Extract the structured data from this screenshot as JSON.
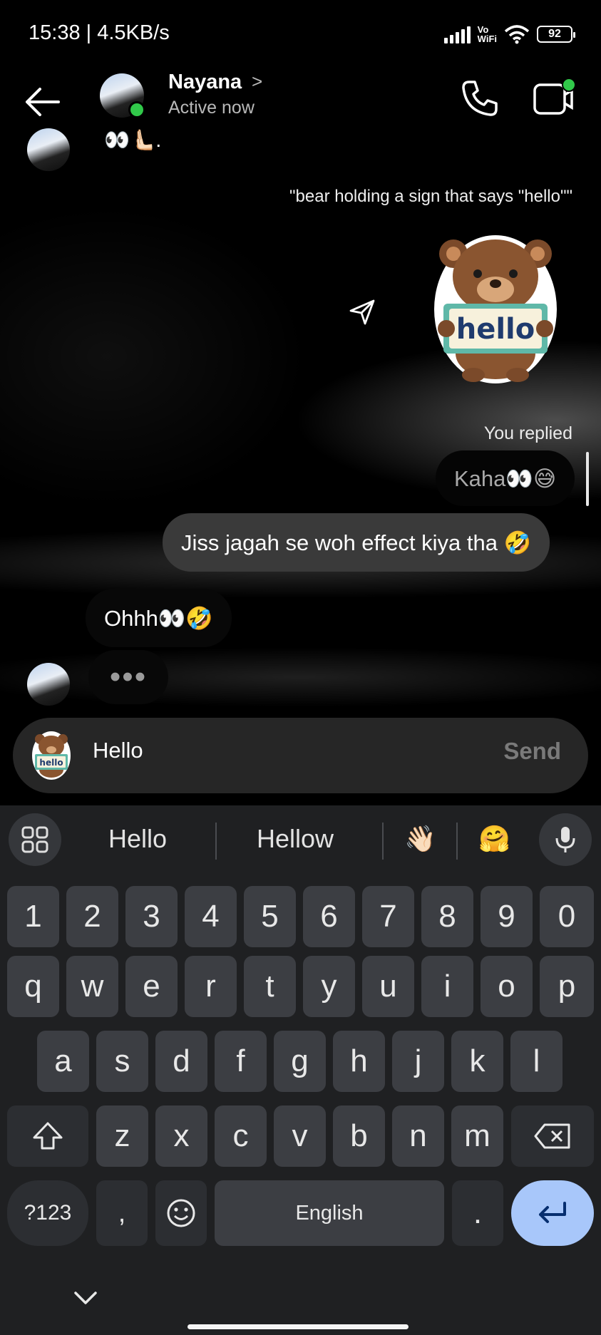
{
  "status_bar": {
    "time_speed": "15:38 | 4.5KB/s",
    "vo_line1": "Vo",
    "vo_line2": "WiFi",
    "battery": "92"
  },
  "header": {
    "contact_name": "Nayana",
    "chevron": ">",
    "status": "Active now"
  },
  "messages": {
    "partial_top_emojis": "👀🫷🏻.",
    "sticker_prompt": "\"bear holding a sign that says \"hello\"\"",
    "sticker_sign_text": "hello",
    "reply_label": "You replied",
    "quoted_reply": "Kaha👀😅",
    "outgoing_message": "Jiss jagah se woh effect kiya tha 🤣",
    "incoming_message": "Ohhh👀🤣",
    "typing_indicator": "•••"
  },
  "composer": {
    "sticker_text": "hello",
    "input_value": "Hello",
    "send_label": "Send"
  },
  "keyboard": {
    "suggestions": [
      "Hello",
      "Hellow",
      "👋🏻",
      "🤗"
    ],
    "number_row": [
      "1",
      "2",
      "3",
      "4",
      "5",
      "6",
      "7",
      "8",
      "9",
      "0"
    ],
    "row1": [
      "q",
      "w",
      "e",
      "r",
      "t",
      "y",
      "u",
      "i",
      "o",
      "p"
    ],
    "row2": [
      "a",
      "s",
      "d",
      "f",
      "g",
      "h",
      "j",
      "k",
      "l"
    ],
    "row3": [
      "z",
      "x",
      "c",
      "v",
      "b",
      "n",
      "m"
    ],
    "symbols_label": "?123",
    "comma": ",",
    "space_label": "English",
    "period": "."
  },
  "colors": {
    "online": "#31c94a",
    "enter_key": "#a8c7fa",
    "bubble_outgoing": "#3a3a3a",
    "composer": "#262626"
  }
}
